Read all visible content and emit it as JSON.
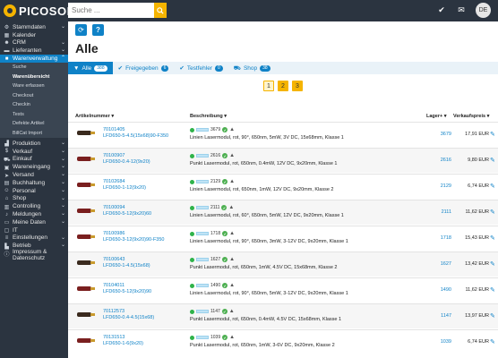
{
  "app": {
    "logo_text": "PICOSOFT"
  },
  "search": {
    "placeholder": "Suche ..."
  },
  "topbar": {
    "avatar_initials": "DE"
  },
  "sidebar": {
    "items": [
      {
        "label": "Stammdaten",
        "icon": "gear-icon",
        "chevron": true
      },
      {
        "label": "Kalender",
        "icon": "calendar-icon",
        "chevron": false
      },
      {
        "label": "CRM",
        "icon": "users-icon",
        "chevron": true
      },
      {
        "label": "Lieferanten",
        "icon": "truck-icon",
        "chevron": true
      },
      {
        "label": "Warenverwaltung",
        "icon": "box-icon",
        "chevron": true,
        "active": true
      }
    ],
    "sub_items": [
      {
        "label": "Suche"
      },
      {
        "label": "Warenübersicht",
        "current": true
      },
      {
        "label": "Ware erfassen"
      },
      {
        "label": "Checkout"
      },
      {
        "label": "Checkin"
      },
      {
        "label": "Tests"
      },
      {
        "label": "Defekte Artikel"
      },
      {
        "label": "BillCat Import"
      }
    ],
    "items2": [
      {
        "label": "Produktion",
        "icon": "factory-icon",
        "chevron": true
      },
      {
        "label": "Verkauf",
        "icon": "dollar-icon",
        "chevron": true
      },
      {
        "label": "Einkauf",
        "icon": "cart-icon",
        "chevron": true
      },
      {
        "label": "Wareneingang",
        "icon": "inbox-icon",
        "chevron": true
      },
      {
        "label": "Versand",
        "icon": "send-icon",
        "chevron": true
      },
      {
        "label": "Buchhaltung",
        "icon": "ledger-icon",
        "chevron": true
      },
      {
        "label": "Personal",
        "icon": "person-icon",
        "chevron": true
      },
      {
        "label": "Shop",
        "icon": "shop-icon",
        "chevron": true
      },
      {
        "label": "Controlling",
        "icon": "chart-icon",
        "chevron": true
      },
      {
        "label": "Meldungen",
        "icon": "bell-icon",
        "chevron": true
      },
      {
        "label": "Meine Daten",
        "icon": "id-icon",
        "chevron": true
      },
      {
        "label": "IT",
        "icon": "monitor-icon",
        "chevron": false
      },
      {
        "label": "Einstellungen",
        "icon": "sliders-icon",
        "chevron": true
      },
      {
        "label": "Betrieb",
        "icon": "building-icon",
        "chevron": true
      },
      {
        "label": "Impressum & Datenschutz",
        "icon": "info-icon",
        "chevron": false
      }
    ]
  },
  "page": {
    "title": "Alle",
    "tabs": [
      {
        "label": "Alle",
        "count": "388",
        "icon": "filter-icon",
        "active": true
      },
      {
        "label": "Freigegeben",
        "count": "6",
        "icon": "check-icon",
        "active": false
      },
      {
        "label": "Testfehler",
        "count": "0",
        "icon": "check-icon",
        "active": false
      },
      {
        "label": "Shop",
        "count": "38",
        "icon": "cart-icon",
        "active": false
      }
    ],
    "pages": [
      "1",
      "2",
      "3"
    ],
    "columns": {
      "artnr": "Artikelnummer ▾",
      "desc": "Beschreibung ▾",
      "lager": "Lager+ ▾",
      "price": "Verkaufspreis ▾"
    }
  },
  "rows": [
    {
      "artnr": "70101405",
      "code": "LFD650-5-4.5(15x68)90-F350",
      "qty": "3679",
      "desc": "Linien Lasermodul, rot, 90°, 650nm, 5mW, 3V DC, 15x68mm, Klasse 1",
      "lager": "3679",
      "price": "17,91 EUR",
      "thumb": "dark"
    },
    {
      "artnr": "70100907",
      "code": "LFD650-0.4-12(9x20)",
      "qty": "2616",
      "desc": "Punkt Lasermodul, rot, 650nm, 0.4mW, 12V DC, 9x20mm, Klasse 1",
      "lager": "2616",
      "price": "9,80 EUR",
      "thumb": "red"
    },
    {
      "artnr": "70102684",
      "code": "LFD650-1-12(9x20)",
      "qty": "2129",
      "desc": "Linien Lasermodul, rot, 650nm, 1mW, 12V DC, 9x20mm, Klasse 2",
      "lager": "2129",
      "price": "6,74 EUR",
      "thumb": "red"
    },
    {
      "artnr": "70100094",
      "code": "LFD650-5-12(9x20)60",
      "qty": "2111",
      "desc": "Linien Lasermodul, rot, 60°, 650nm, 5mW, 12V DC, 9x20mm, Klasse 1",
      "lager": "2111",
      "price": "11,62 EUR",
      "thumb": "red"
    },
    {
      "artnr": "70100986",
      "code": "LFD650-3-12(9x20)90-F350",
      "qty": "1718",
      "desc": "Linien Lasermodul, rot, 90°, 650nm, 3mW, 3-12V DC, 9x20mm, Klasse 1",
      "lager": "1718",
      "price": "15,43 EUR",
      "thumb": "red"
    },
    {
      "artnr": "70100643",
      "code": "LFD650-1-4.5(15x68)",
      "qty": "1627",
      "desc": "Punkt Lasermodul, rot, 650nm, 1mW, 4.5V DC, 15x68mm, Klasse 2",
      "lager": "1627",
      "price": "13,42 EUR",
      "thumb": "dark"
    },
    {
      "artnr": "70104011",
      "code": "LFD650-5-12(9x20)90",
      "qty": "1490",
      "desc": "Linien Lasermodul, rot, 90°, 650nm, 5mW, 3-12V DC, 9x20mm, Klasse 1",
      "lager": "1490",
      "price": "11,62 EUR",
      "thumb": "red"
    },
    {
      "artnr": "70112573",
      "code": "LFD650-0.4-4.5(15x68)",
      "qty": "1147",
      "desc": "Punkt Lasermodul, rot, 650nm, 0.4mW, 4.5V DC, 15x68mm, Klasse 1",
      "lager": "1147",
      "price": "13,97 EUR",
      "thumb": "dark"
    },
    {
      "artnr": "70131513",
      "code": "LFD650-1-6(9x20)",
      "qty": "1039",
      "desc": "Punkt Lasermodul, rot, 650nm, 1mW, 3-6V DC, 9x20mm, Klasse 2",
      "lager": "1039",
      "price": "6,74 EUR",
      "thumb": "red"
    }
  ]
}
